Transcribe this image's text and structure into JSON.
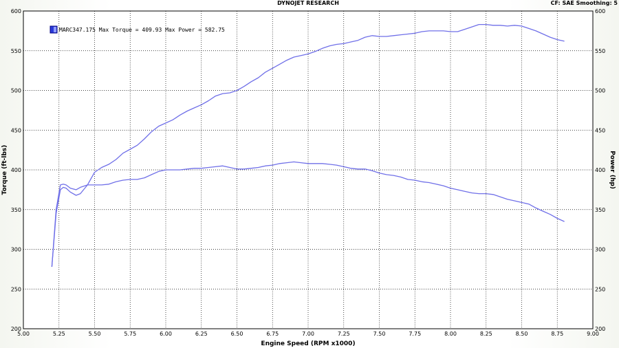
{
  "header": {
    "title": "DYNOJET RESEARCH",
    "settings": "CF: SAE  Smoothing: 5"
  },
  "colors": {
    "series": "#6f6fe8",
    "grid": "#000000",
    "legend_swatch": "#2a3ad8"
  },
  "chart_data": {
    "type": "line",
    "xlabel": "Engine Speed (RPM x1000)",
    "ylabel_left": "Torque (ft-lbs)",
    "ylabel_right": "Power (hp)",
    "xlim": [
      5.0,
      9.0
    ],
    "ylim": [
      200,
      600
    ],
    "x_ticks": [
      "5.00",
      "5.25",
      "5.50",
      "5.75",
      "6.00",
      "6.25",
      "6.50",
      "6.75",
      "7.00",
      "7.25",
      "7.50",
      "7.75",
      "8.00",
      "8.25",
      "8.50",
      "8.75",
      "9.00"
    ],
    "y_ticks": [
      "200",
      "250",
      "300",
      "350",
      "400",
      "450",
      "500",
      "550",
      "600"
    ],
    "grid": true,
    "legend": {
      "position": "top-left",
      "text": "MARC347.175 Max Torque = 409.93 Max Power = 582.75"
    },
    "series": [
      {
        "role": "power",
        "x": [
          5.2,
          5.23,
          5.26,
          5.28,
          5.3,
          5.33,
          5.37,
          5.4,
          5.45,
          5.5,
          5.55,
          5.6,
          5.65,
          5.7,
          5.75,
          5.8,
          5.85,
          5.9,
          5.95,
          6.0,
          6.05,
          6.1,
          6.15,
          6.2,
          6.25,
          6.3,
          6.35,
          6.4,
          6.45,
          6.5,
          6.55,
          6.6,
          6.65,
          6.7,
          6.75,
          6.8,
          6.85,
          6.9,
          6.95,
          7.0,
          7.05,
          7.1,
          7.15,
          7.2,
          7.25,
          7.3,
          7.35,
          7.4,
          7.45,
          7.5,
          7.55,
          7.6,
          7.65,
          7.7,
          7.75,
          7.8,
          7.85,
          7.9,
          7.95,
          8.0,
          8.05,
          8.1,
          8.15,
          8.2,
          8.25,
          8.3,
          8.35,
          8.4,
          8.45,
          8.5,
          8.55,
          8.6,
          8.65,
          8.7,
          8.75,
          8.8
        ],
        "y": [
          278,
          345,
          375,
          378,
          377,
          372,
          368,
          370,
          381,
          397,
          403,
          407,
          413,
          421,
          426,
          431,
          439,
          448,
          455,
          459,
          463,
          469,
          474,
          478,
          482,
          487,
          493,
          496,
          497,
          500,
          505,
          511,
          516,
          523,
          528,
          533,
          538,
          542,
          544,
          546,
          549,
          553,
          556,
          558,
          559,
          561,
          563,
          567,
          569,
          568,
          568,
          569,
          570,
          571,
          572,
          574,
          575,
          575,
          575,
          574,
          574,
          577,
          580,
          583,
          583,
          582,
          582,
          581,
          582,
          581,
          578,
          575,
          571,
          567,
          564,
          562
        ],
        "max": 582.75
      },
      {
        "role": "torque",
        "x": [
          5.2,
          5.23,
          5.26,
          5.28,
          5.3,
          5.33,
          5.37,
          5.4,
          5.45,
          5.5,
          5.55,
          5.6,
          5.65,
          5.7,
          5.75,
          5.8,
          5.85,
          5.9,
          5.95,
          6.0,
          6.05,
          6.1,
          6.15,
          6.2,
          6.25,
          6.3,
          6.35,
          6.4,
          6.45,
          6.5,
          6.55,
          6.6,
          6.65,
          6.7,
          6.75,
          6.8,
          6.85,
          6.9,
          6.95,
          7.0,
          7.05,
          7.1,
          7.15,
          7.2,
          7.25,
          7.3,
          7.35,
          7.4,
          7.45,
          7.5,
          7.55,
          7.6,
          7.65,
          7.7,
          7.75,
          7.8,
          7.85,
          7.9,
          7.95,
          8.0,
          8.05,
          8.1,
          8.15,
          8.2,
          8.25,
          8.3,
          8.35,
          8.4,
          8.45,
          8.5,
          8.55,
          8.6,
          8.65,
          8.7,
          8.75,
          8.8
        ],
        "y": [
          278,
          350,
          381,
          382,
          381,
          377,
          375,
          378,
          381,
          381,
          381,
          382,
          385,
          387,
          388,
          388,
          390,
          394,
          398,
          400,
          400,
          400,
          401,
          402,
          402,
          403,
          404,
          405,
          403,
          401,
          401,
          402,
          403,
          405,
          406,
          408,
          409,
          410,
          409,
          408,
          408,
          408,
          407,
          406,
          404,
          402,
          401,
          401,
          399,
          396,
          394,
          393,
          391,
          388,
          387,
          385,
          384,
          382,
          380,
          377,
          375,
          373,
          371,
          370,
          370,
          369,
          366,
          363,
          361,
          359,
          357,
          352,
          348,
          344,
          339,
          335
        ],
        "max": 409.93
      }
    ]
  }
}
